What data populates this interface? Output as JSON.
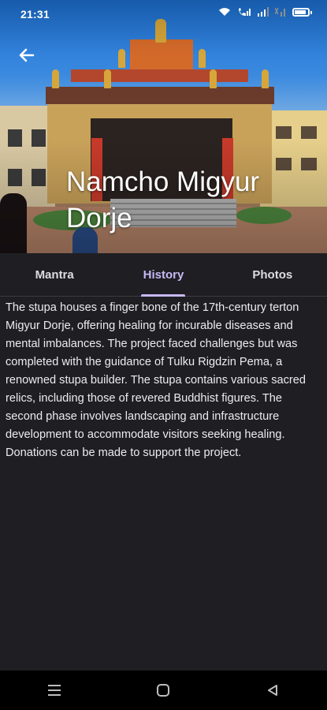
{
  "status_bar": {
    "time": "21:31",
    "icons": [
      "wifi-icon",
      "volte-icon",
      "signal-icon",
      "signal-2-icon",
      "battery-icon"
    ],
    "battery_level": 0.9
  },
  "header": {
    "back_icon": "arrow-left-icon",
    "title": "Namcho Migyur Dorje"
  },
  "tabs": [
    {
      "label": "Mantra",
      "active": false
    },
    {
      "label": "History",
      "active": true
    },
    {
      "label": "Photos",
      "active": false
    }
  ],
  "content": {
    "history_text": "The stupa houses a finger bone of the 17th-century terton Migyur Dorje, offering healing for incurable diseases and mental imbalances. The project faced challenges but was completed with the guidance of Tulku Rigdzin Pema, a renowned stupa builder. The stupa contains various sacred relics, including those of revered Buddhist figures. The second phase involves landscaping and infrastructure development to accommodate visitors seeking healing. Donations can be made to support the project."
  },
  "navigation_bar": {
    "buttons": [
      "menu-icon",
      "home-icon",
      "back-triangle-icon"
    ]
  },
  "colors": {
    "background": "#1f1f23",
    "active_tab": "#c7b8f5",
    "text": "#ececf0"
  }
}
